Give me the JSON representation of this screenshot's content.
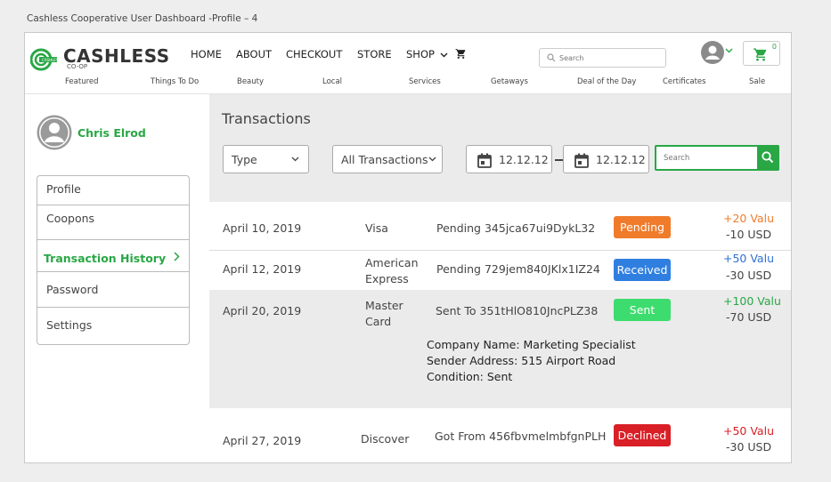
{
  "window": {
    "title": "Cashless Cooperative User Dashboard -Profile – 4"
  },
  "brand": {
    "name": "CASHLESS",
    "sub": "CO-OP",
    "accent": "#29a745"
  },
  "nav": {
    "items": [
      "HOME",
      "ABOUT",
      "CHECKOUT",
      "STORE",
      "SHOP"
    ],
    "search_placeholder": "Search",
    "cart_count": "0"
  },
  "subnav": [
    "Featured",
    "Things To Do",
    "Beauty",
    "Local",
    "Services",
    "Getaways",
    "Deal of the Day",
    "Certificates",
    "Sale"
  ],
  "user": {
    "name": "Chris Elrod"
  },
  "sidebar": {
    "items": [
      {
        "label": "Profile",
        "active": false
      },
      {
        "label": "Coopons",
        "active": false
      },
      {
        "label": "Transaction History",
        "active": true
      },
      {
        "label": "Password",
        "active": false
      },
      {
        "label": "Settings",
        "active": false
      }
    ]
  },
  "main": {
    "title": "Transactions",
    "filters": {
      "type": "Type",
      "transactions": "All Transactions",
      "date_from": "12.12.12",
      "date_to": "12.12.12",
      "search_placeholder": "Search"
    },
    "transactions": [
      {
        "date": "April 10, 2019",
        "method": "Visa",
        "desc": "Pending 345jca67ui9DykL32",
        "status": "Pending",
        "status_color": "#f07b2b",
        "valu": "+20 Valu",
        "valu_color": "#f07b2b",
        "usd": "-10 USD"
      },
      {
        "date": "April 12, 2019",
        "method": "American Express",
        "desc": "Pending 729jem840JKlx1IZ24",
        "status": "Received",
        "status_color": "#2f7fe0",
        "valu": "+50 Valu",
        "valu_color": "#2f6fd0",
        "usd": "-30 USD"
      },
      {
        "date": "April 20, 2019",
        "method": "Master Card",
        "desc": "Sent To  351tHlO810JncPLZ38",
        "status": "Sent",
        "status_color": "#3ddc6e",
        "valu": "+100 Valu",
        "valu_color": "#29a745",
        "usd": "-70 USD"
      },
      {
        "date": "April 27, 2019",
        "method": "Discover",
        "desc": "Got From 456fbvmelmbfgnPLH",
        "status": "Declined",
        "status_color": "#d92027",
        "valu": "+50 Valu",
        "valu_color": "#d92027",
        "usd": "-30 USD"
      }
    ],
    "details": {
      "company": "Company Name: Marketing Specialist",
      "address": "Sender Address: 515 Airport Road",
      "condition": "Condition: Sent"
    }
  }
}
